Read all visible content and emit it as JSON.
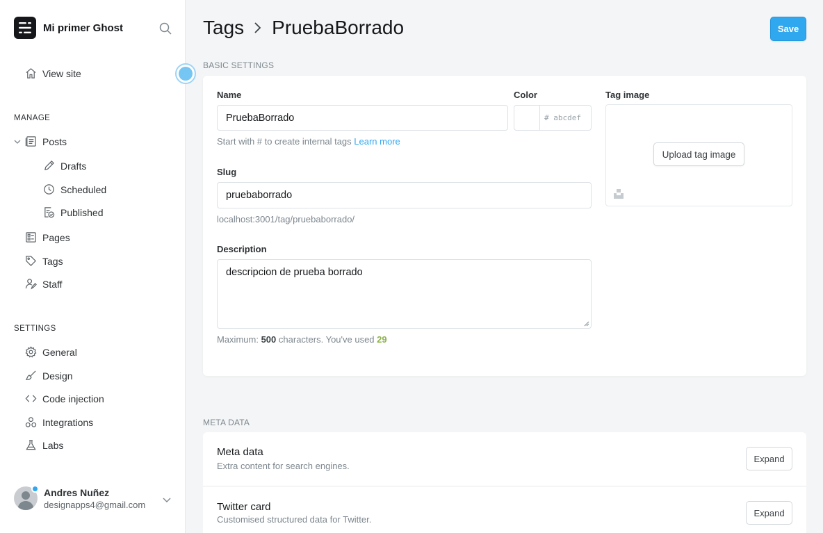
{
  "sidebar": {
    "site_title": "Mi primer Ghost",
    "view_site": "View site",
    "manage_label": "MANAGE",
    "posts": "Posts",
    "drafts": "Drafts",
    "scheduled": "Scheduled",
    "published": "Published",
    "pages": "Pages",
    "tags": "Tags",
    "staff": "Staff",
    "settings_label": "SETTINGS",
    "general": "General",
    "design": "Design",
    "code_injection": "Code injection",
    "integrations": "Integrations",
    "labs": "Labs",
    "user_name": "Andres Nuñez",
    "user_email": "designapps4@gmail.com"
  },
  "header": {
    "crumb_parent": "Tags",
    "crumb_current": "PruebaBorrado",
    "save_label": "Save"
  },
  "basic": {
    "section_label": "BASIC SETTINGS",
    "name_label": "Name",
    "name_value": "PruebaBorrado",
    "name_hint": "Start with # to create internal tags",
    "learn_more": "Learn more",
    "color_label": "Color",
    "color_placeholder": "# abcdef",
    "slug_label": "Slug",
    "slug_value": "pruebaborrado",
    "slug_url": "localhost:3001/tag/pruebaborrado/",
    "description_label": "Description",
    "description_value": "descripcion de prueba borrado",
    "max_prefix": "Maximum:",
    "max_value": "500",
    "max_middle": "characters. You've used",
    "used_value": "29",
    "image_label": "Tag image",
    "upload_label": "Upload tag image"
  },
  "meta": {
    "section_label": "META DATA",
    "rows": [
      {
        "title": "Meta data",
        "subtitle": "Extra content for search engines.",
        "button": "Expand"
      },
      {
        "title": "Twitter card",
        "subtitle": "Customised structured data for Twitter.",
        "button": "Expand"
      }
    ]
  },
  "colors": {
    "accent": "#30a8f0",
    "used_count": "#8cb34a",
    "background": "#f4f5f6"
  }
}
